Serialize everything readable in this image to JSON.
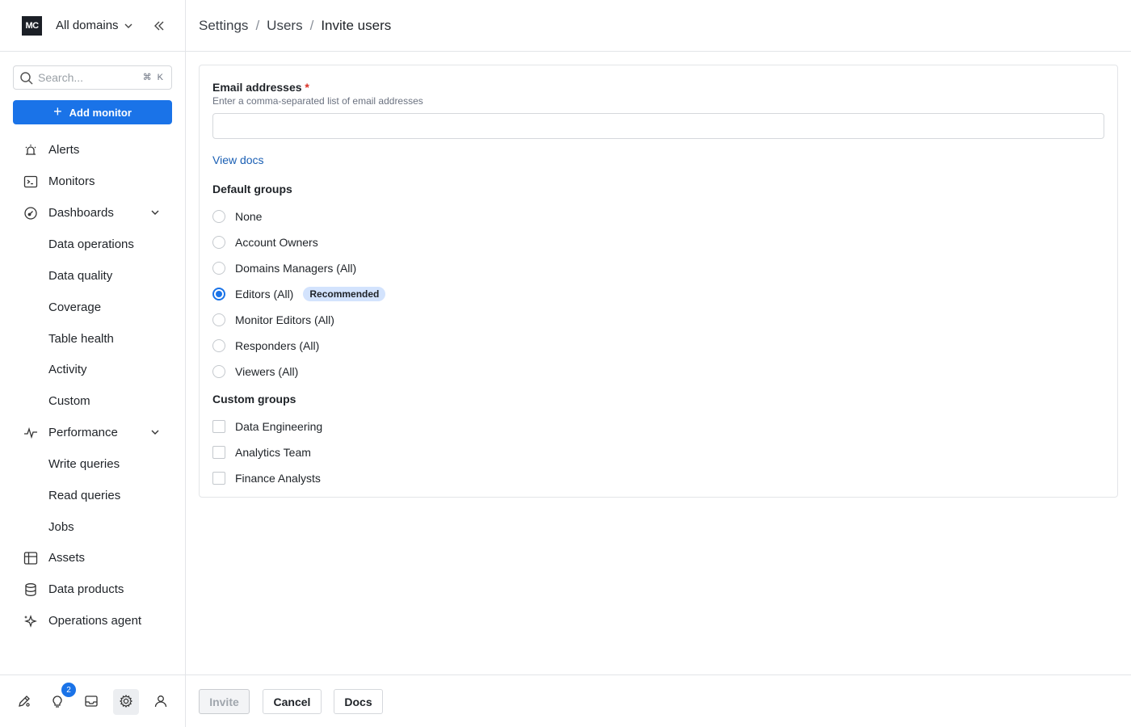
{
  "sidebar": {
    "logo_text": "MC",
    "domain_selector": "All domains",
    "search": {
      "placeholder": "Search...",
      "shortcut": "⌘ K"
    },
    "add_monitor_label": "Add monitor",
    "nav": {
      "alerts": "Alerts",
      "monitors": "Monitors",
      "dashboards": "Dashboards",
      "data_operations": "Data operations",
      "data_quality": "Data quality",
      "coverage": "Coverage",
      "table_health": "Table health",
      "activity": "Activity",
      "custom": "Custom",
      "performance": "Performance",
      "write_queries": "Write queries",
      "read_queries": "Read queries",
      "jobs": "Jobs",
      "assets": "Assets",
      "data_products": "Data products",
      "operations_agent": "Operations agent"
    },
    "notification_count": "2"
  },
  "breadcrumb": {
    "settings": "Settings",
    "users": "Users",
    "current": "Invite users",
    "separator": "/"
  },
  "form": {
    "email_label": "Email addresses",
    "required_mark": "*",
    "email_help": "Enter a comma-separated list of email addresses",
    "email_value": "",
    "view_docs": "View docs",
    "default_groups_title": "Default groups",
    "default_groups": [
      {
        "label": "None",
        "checked": false
      },
      {
        "label": "Account Owners",
        "checked": false
      },
      {
        "label": "Domains Managers (All)",
        "checked": false
      },
      {
        "label": "Editors (All)",
        "checked": true,
        "badge": "Recommended"
      },
      {
        "label": "Monitor Editors (All)",
        "checked": false
      },
      {
        "label": "Responders (All)",
        "checked": false
      },
      {
        "label": "Viewers (All)",
        "checked": false
      }
    ],
    "custom_groups_title": "Custom groups",
    "custom_groups": [
      {
        "label": "Data Engineering",
        "checked": false
      },
      {
        "label": "Analytics Team",
        "checked": false
      },
      {
        "label": "Finance Analysts",
        "checked": false
      }
    ]
  },
  "footer": {
    "invite": "Invite",
    "cancel": "Cancel",
    "docs": "Docs"
  },
  "colors": {
    "accent": "#1a73e8",
    "badge_bg": "#d3e3fd",
    "required": "#d93025"
  }
}
